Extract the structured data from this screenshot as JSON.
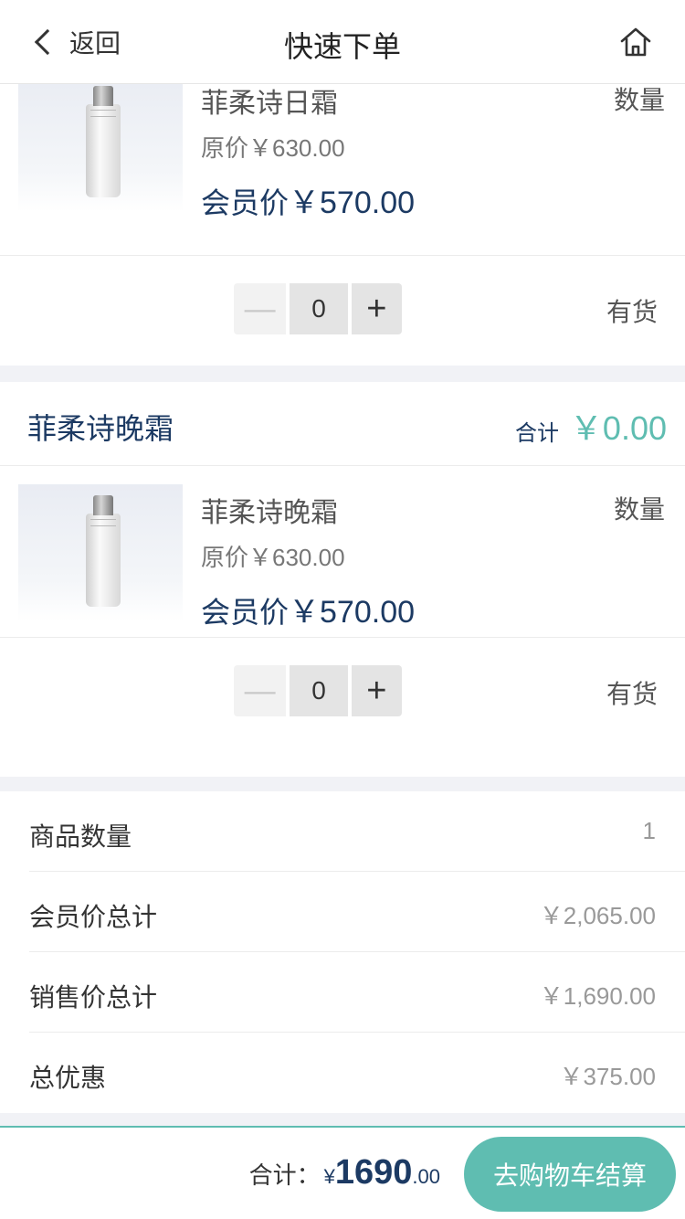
{
  "nav": {
    "back_label": "返回",
    "title": "快速下单"
  },
  "products": [
    {
      "name": "菲柔诗日霜",
      "qty_label": "数量",
      "orig_label": "原价",
      "orig_price": "￥630.00",
      "member_label": "会员价",
      "member_price": "￥570.00",
      "qty_value": "0",
      "minus": "—",
      "plus": "+",
      "stock": "有货"
    },
    {
      "name": "菲柔诗晚霜",
      "qty_label": "数量",
      "orig_label": "原价",
      "orig_price": "￥630.00",
      "member_label": "会员价",
      "member_price": "￥570.00",
      "qty_value": "0",
      "minus": "—",
      "plus": "+",
      "stock": "有货"
    }
  ],
  "group2": {
    "name": "菲柔诗晚霜",
    "sum_label": "合计",
    "sum_value": "￥0.00"
  },
  "summary": [
    {
      "key": "商品数量",
      "value": "1"
    },
    {
      "key": "会员价总计",
      "value": "￥2,065.00"
    },
    {
      "key": "销售价总计",
      "value": "￥1,690.00"
    },
    {
      "key": "总优惠",
      "value": "￥375.00"
    }
  ],
  "bottom": {
    "total_label": "合计：",
    "currency": "¥",
    "total_int": "1690",
    "total_dec": ".00",
    "checkout_label": "去购物车结算"
  },
  "colors": {
    "navy": "#1c3a63",
    "teal": "#5fbdb1",
    "bg": "#f1f2f6"
  }
}
